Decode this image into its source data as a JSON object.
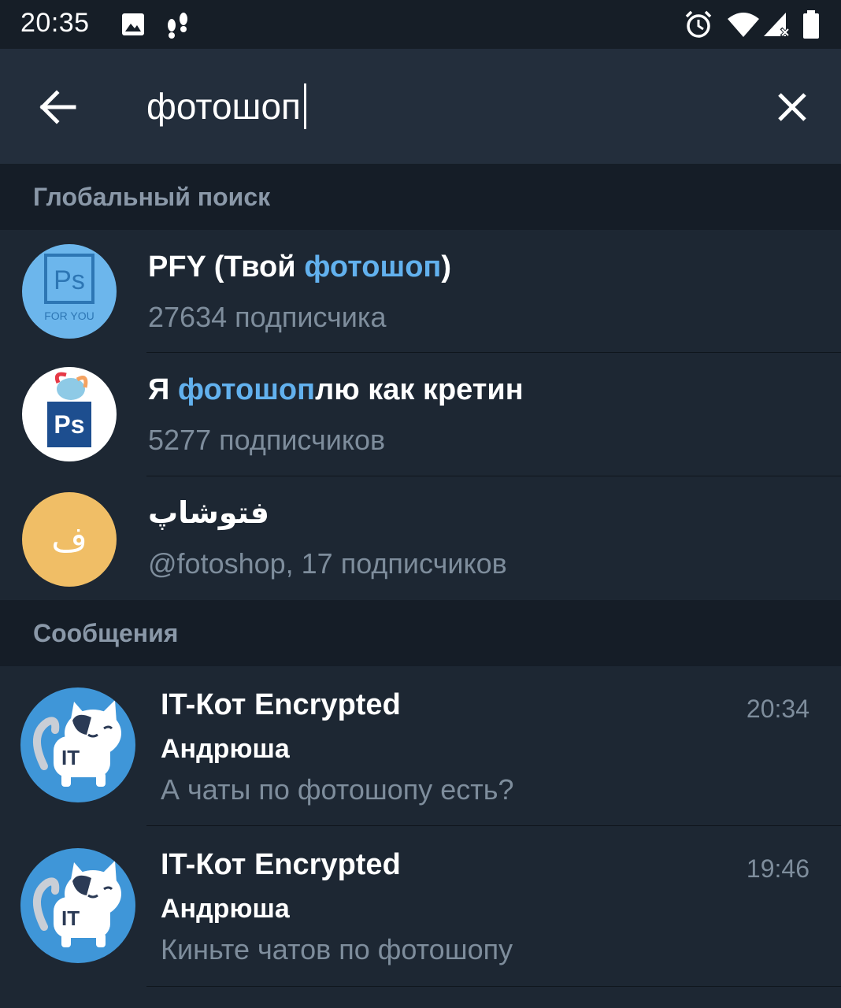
{
  "status_bar": {
    "time": "20:35",
    "icons": [
      "image-icon",
      "footsteps-icon",
      "alarm-icon",
      "wifi-icon",
      "signal-icon",
      "battery-icon"
    ]
  },
  "search": {
    "query": "фотошоп",
    "back_icon": "arrow-left-icon",
    "clear_icon": "close-icon"
  },
  "global_search": {
    "header": "Глобальный поиск",
    "results": [
      {
        "title_before": "PFY (Твой ",
        "title_highlight": "фотошоп",
        "title_after": ")",
        "subtitle": "27634 подписчика",
        "avatar_text": "Ps",
        "avatar_caption": "FOR YOU",
        "avatar_color": "#6cb6ec"
      },
      {
        "title_before": "Я ",
        "title_highlight": "фотошоп",
        "title_after": "лю как кретин",
        "subtitle": "5277 подписчиков",
        "avatar_text": "Ps",
        "avatar_color": "#ffffff"
      },
      {
        "title_before": "فتوشاپ",
        "title_highlight": "",
        "title_after": "",
        "subtitle": "@fotoshop, 17 подписчиков",
        "avatar_text": "ف",
        "avatar_color": "#f0be66"
      }
    ]
  },
  "messages": {
    "header": "Сообщения",
    "items": [
      {
        "chat": "IT-Кот Encrypted",
        "time": "20:34",
        "sender": "Андрюша",
        "text": "А чаты по фотошопу есть?",
        "avatar_color": "#3f96d8"
      },
      {
        "chat": "IT-Кот Encrypted",
        "time": "19:46",
        "sender": "Андрюша",
        "text": "Киньте чатов по фотошопу",
        "avatar_color": "#3f96d8"
      }
    ]
  },
  "colors": {
    "background": "#1d2733",
    "header": "#232e3c",
    "section": "#151d27",
    "highlight": "#62b1ee",
    "secondary_text": "#7e8d9c"
  }
}
